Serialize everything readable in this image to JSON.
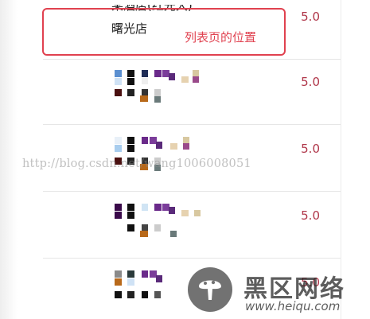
{
  "list": {
    "first_item": {
      "name_line1": "某酒店(红光大)",
      "name_line2": "曙光店",
      "score": "5.0"
    },
    "items": [
      {
        "score": "5.0"
      },
      {
        "score": "5.0"
      },
      {
        "score": "5.0"
      },
      {
        "score": "5.0"
      }
    ]
  },
  "annotation": {
    "label": "列表页的位置",
    "color": "#e0414f"
  },
  "watermark": {
    "text": "http://blog.csdn.net/wang1006008051"
  },
  "logo": {
    "title": "黑区网络",
    "url": "www.heiqu.com",
    "icon": "mushroom-icon"
  },
  "colors": {
    "score": "#b0374a",
    "mosaic_purple": "#6a2a8a",
    "mosaic_blue": "#4a8fd6"
  }
}
